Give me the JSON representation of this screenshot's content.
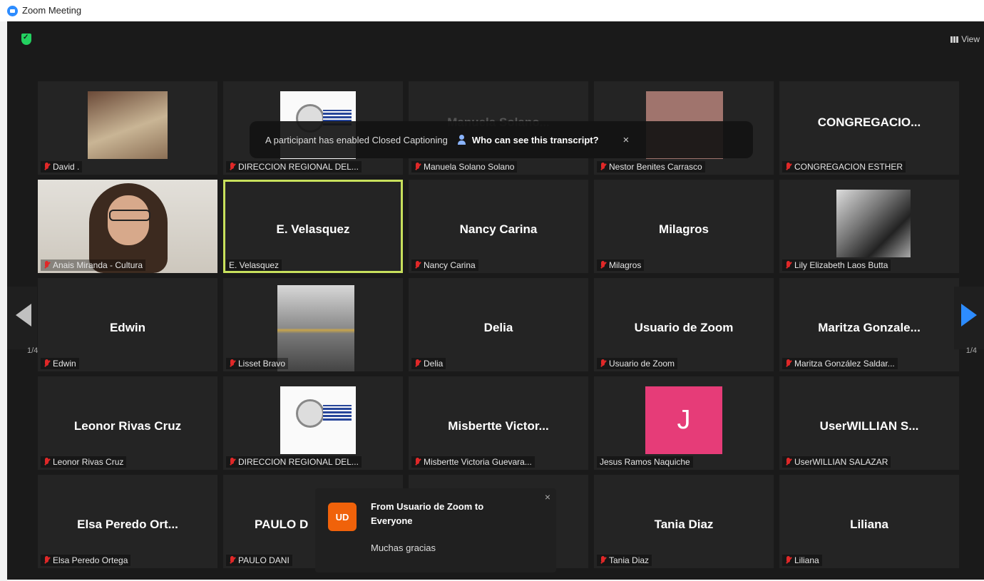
{
  "window": {
    "title": "Zoom Meeting"
  },
  "toolbar": {
    "view_label": "View"
  },
  "banner": {
    "text": "A participant has enabled Closed Captioning",
    "link": "Who can see this transcript?",
    "close": "×"
  },
  "pagination": {
    "left": "1/4",
    "right": "1/4"
  },
  "participants": [
    {
      "display": "",
      "label": "David .",
      "muted": true
    },
    {
      "display": "",
      "label": "DIRECCION REGIONAL DEL...",
      "muted": true
    },
    {
      "display": "Manuela Solano...",
      "label": "Manuela Solano Solano",
      "muted": true
    },
    {
      "display": "",
      "label": "Nestor Benites Carrasco",
      "muted": true
    },
    {
      "display": "CONGREGACIO...",
      "label": "CONGREGACION ESTHER",
      "muted": true
    },
    {
      "display": "",
      "label": "Anais Miranda - Cultura",
      "muted": true
    },
    {
      "display": "E. Velasquez",
      "label": "E. Velasquez",
      "muted": false
    },
    {
      "display": "Nancy Carina",
      "label": "Nancy Carina",
      "muted": true
    },
    {
      "display": "Milagros",
      "label": "Milagros",
      "muted": true
    },
    {
      "display": "",
      "label": "Lily Elizabeth Laos Butta",
      "muted": true
    },
    {
      "display": "Edwin",
      "label": "Edwin",
      "muted": true
    },
    {
      "display": "",
      "label": "Lisset Bravo",
      "muted": true
    },
    {
      "display": "Delia",
      "label": "Delia",
      "muted": true
    },
    {
      "display": "Usuario de Zoom",
      "label": "Usuario de Zoom",
      "muted": true
    },
    {
      "display": "Maritza Gonzale...",
      "label": "Maritza González Saldar...",
      "muted": true
    },
    {
      "display": "Leonor Rivas Cruz",
      "label": "Leonor Rivas Cruz",
      "muted": true
    },
    {
      "display": "",
      "label": "DIRECCION REGIONAL DEL...",
      "muted": true
    },
    {
      "display": "Misbertte Victor...",
      "label": "Misbertte Victoria Guevara...",
      "muted": true
    },
    {
      "display": "J",
      "label": "Jesus Ramos Naquiche",
      "muted": false
    },
    {
      "display": "UserWILLIAN S...",
      "label": "UserWILLIAN SALAZAR",
      "muted": true
    },
    {
      "display": "Elsa Peredo Ort...",
      "label": "Elsa Peredo Ortega",
      "muted": true
    },
    {
      "display": "PAULO D",
      "label": "PAULO DANI",
      "muted": true
    },
    {
      "display": "",
      "label": "",
      "muted": false
    },
    {
      "display": "Tania Diaz",
      "label": "Tania Diaz",
      "muted": true
    },
    {
      "display": "Liliana",
      "label": "Liliana",
      "muted": true
    }
  ],
  "chat": {
    "avatar_initials": "UD",
    "from": "From Usuario de Zoom to Everyone",
    "message": "Muchas gracias",
    "close": "×"
  },
  "colors": {
    "accent": "#2d8cff",
    "active_speaker": "#c8e05c",
    "avatar_j": "#e63c78",
    "chat_avatar": "#f0620a",
    "muted": "#e02828"
  }
}
